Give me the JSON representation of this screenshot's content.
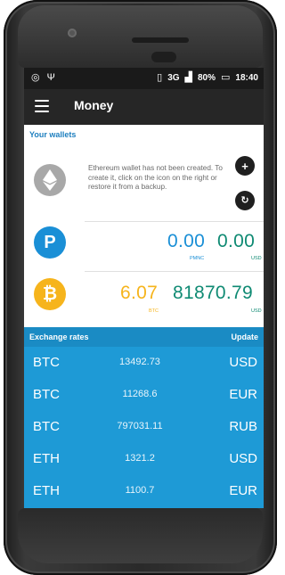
{
  "status_bar": {
    "network": "3G",
    "battery": "80%",
    "time": "18:40"
  },
  "app_bar": {
    "title": "Money"
  },
  "wallets": {
    "section_label": "Your wallets",
    "ethereum_message": "Ethereum wallet has not been created. To create it, click on the icon on the right or restore it from a backup.",
    "pm": {
      "amount": "0.00",
      "unit": "PMNC",
      "fiat_amount": "0.00",
      "fiat_unit": "USD"
    },
    "btc": {
      "amount": "6.07",
      "unit": "BTC",
      "fiat_amount": "81870.79",
      "fiat_unit": "USD"
    }
  },
  "exchange_rates": {
    "title": "Exchange rates",
    "update_label": "Update",
    "rows": [
      {
        "from": "BTC",
        "value": "13492.73",
        "to": "USD"
      },
      {
        "from": "BTC",
        "value": "11268.6",
        "to": "EUR"
      },
      {
        "from": "BTC",
        "value": "797031.11",
        "to": "RUB"
      },
      {
        "from": "ETH",
        "value": "1321.2",
        "to": "USD"
      },
      {
        "from": "ETH",
        "value": "1100.7",
        "to": "EUR"
      }
    ]
  },
  "colors": {
    "accent": "#1e9ad6",
    "btc_amount": "#f6b41c",
    "fiat_amount": "#0f8a73",
    "pm_amount": "#1a8fd6"
  }
}
